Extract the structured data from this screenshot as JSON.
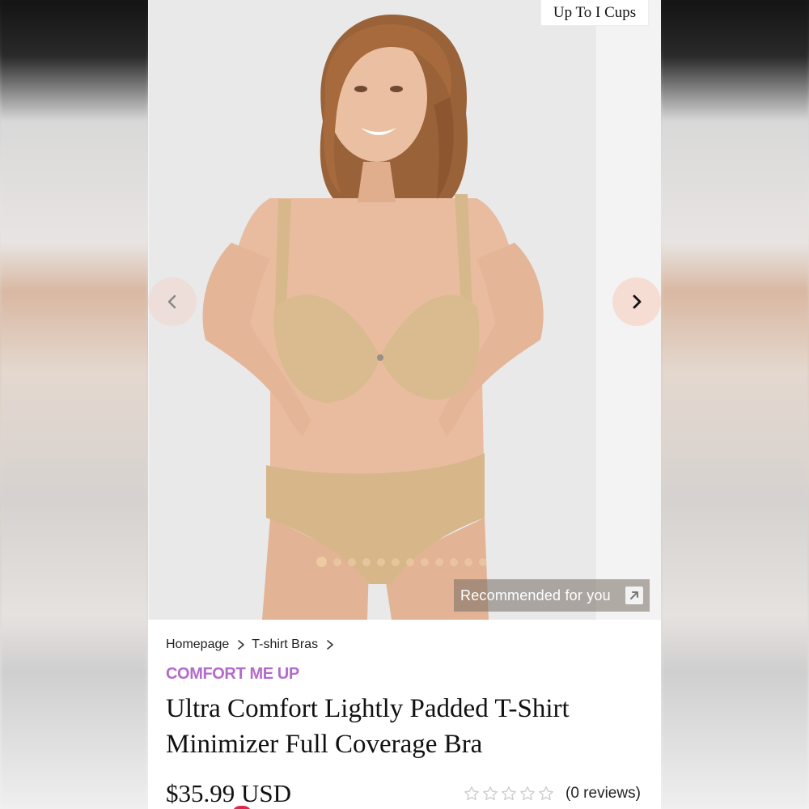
{
  "badge": {
    "cup_range": "Up To I Cups"
  },
  "carousel": {
    "slide_count": 12,
    "active_index": 0,
    "recommended_label": "Recommended for you"
  },
  "breadcrumb": {
    "items": [
      "Homepage",
      "T-shirt Bras"
    ]
  },
  "product": {
    "brand": "COMFORT ME UP",
    "title": "Ultra Comfort Lightly Padded T-Shirt Minimizer Full Coverage Bra",
    "price": "$35.99 USD",
    "rating_stars": 0,
    "max_stars": 5,
    "reviews_label": "(0 reviews)"
  },
  "colors": {
    "brand_accent": "#b36bcc",
    "nav_button_bg": "#f6ddd4",
    "text_primary": "#111111",
    "star_outline": "#cfcfcf",
    "product_nude": "#d9bb8f"
  },
  "icons": {
    "prev": "chevron-left-icon",
    "next": "chevron-right-icon",
    "breadcrumb_separator": "chevron-right-icon",
    "recommended": "arrow-up-right-icon",
    "star": "star-outline-icon"
  }
}
